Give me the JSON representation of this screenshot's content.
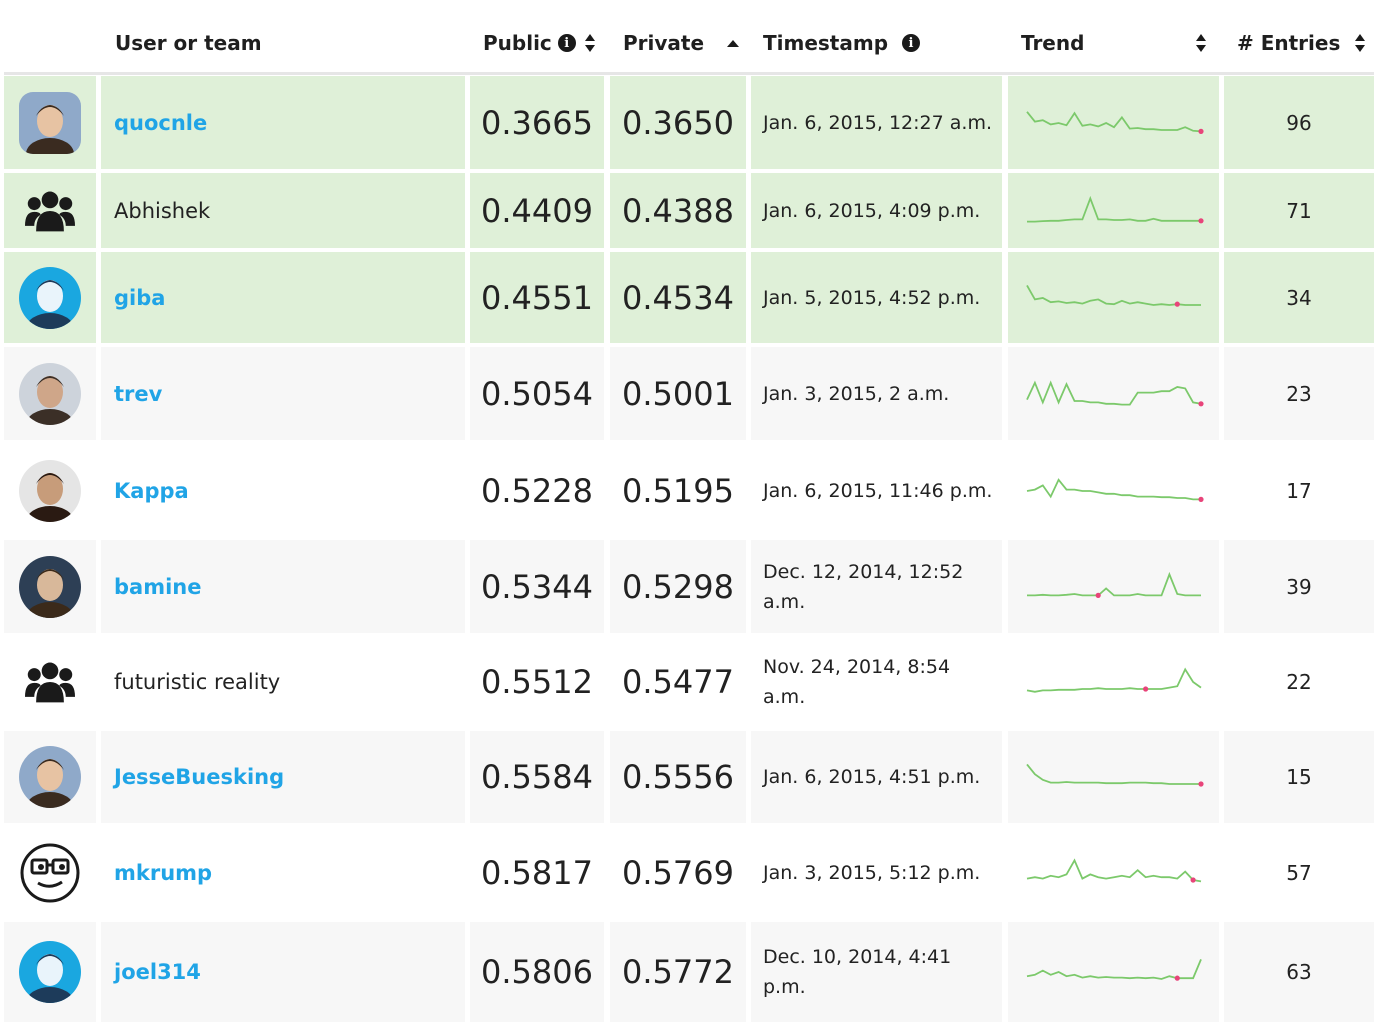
{
  "header": {
    "user_or_team": "User or team",
    "public": "Public",
    "private": "Private",
    "timestamp": "Timestamp",
    "trend": "Trend",
    "entries": "# Entries"
  },
  "colors": {
    "highlight_bg": "#dff0d8",
    "stripe_bg": "#f7f7f7",
    "link": "#20a4e6",
    "trend_line": "#7cc96b",
    "trend_dot": "#e8447a"
  },
  "rows": [
    {
      "name": "quocnle",
      "is_team": false,
      "avatar": "avatar-photo",
      "public": "0.3665",
      "private": "0.3650",
      "timestamp": "Jan. 6, 2015, 12:27 a.m.",
      "entries": "96",
      "highlight": true,
      "trend": [
        0.9,
        0.55,
        0.6,
        0.45,
        0.5,
        0.42,
        0.85,
        0.4,
        0.45,
        0.38,
        0.5,
        0.35,
        0.7,
        0.3,
        0.32,
        0.28,
        0.28,
        0.25,
        0.25,
        0.25,
        0.35,
        0.22,
        0.2
      ],
      "dot": 22
    },
    {
      "name": "Abhishek",
      "is_team": true,
      "avatar": "team-icon",
      "public": "0.4409",
      "private": "0.4388",
      "timestamp": "Jan. 6, 2015, 4:09 p.m.",
      "entries": "71",
      "highlight": true,
      "trend": [
        0.12,
        0.12,
        0.14,
        0.15,
        0.15,
        0.18,
        0.2,
        0.2,
        0.95,
        0.2,
        0.2,
        0.18,
        0.18,
        0.2,
        0.15,
        0.15,
        0.22,
        0.15,
        0.15,
        0.15,
        0.15,
        0.15,
        0.15
      ],
      "dot": 22
    },
    {
      "name": "giba",
      "is_team": false,
      "avatar": "avatar-photo",
      "public": "0.4551",
      "private": "0.4534",
      "timestamp": "Jan. 5, 2015, 4:52 p.m.",
      "entries": "34",
      "highlight": true,
      "trend": [
        0.95,
        0.45,
        0.5,
        0.35,
        0.38,
        0.32,
        0.35,
        0.3,
        0.4,
        0.45,
        0.3,
        0.28,
        0.4,
        0.3,
        0.35,
        0.3,
        0.25,
        0.28,
        0.25,
        0.28,
        0.25,
        0.25,
        0.25
      ],
      "dot": 19
    },
    {
      "name": "trev",
      "is_team": false,
      "avatar": "avatar-photo",
      "public": "0.5054",
      "private": "0.5001",
      "timestamp": "Jan. 3, 2015, 2 a.m.",
      "entries": "23",
      "highlight": false,
      "trend": [
        0.3,
        0.9,
        0.2,
        0.9,
        0.2,
        0.85,
        0.25,
        0.25,
        0.2,
        0.2,
        0.15,
        0.15,
        0.12,
        0.12,
        0.55,
        0.55,
        0.55,
        0.6,
        0.6,
        0.75,
        0.7,
        0.2,
        0.15
      ],
      "dot": 22
    },
    {
      "name": "Kappa",
      "is_team": false,
      "avatar": "avatar-photo",
      "public": "0.5228",
      "private": "0.5195",
      "timestamp": "Jan. 6, 2015, 11:46 p.m.",
      "entries": "17",
      "highlight": false,
      "trend": [
        0.5,
        0.55,
        0.7,
        0.3,
        0.9,
        0.55,
        0.55,
        0.5,
        0.5,
        0.45,
        0.4,
        0.4,
        0.35,
        0.35,
        0.3,
        0.3,
        0.3,
        0.28,
        0.28,
        0.25,
        0.25,
        0.2,
        0.2
      ],
      "dot": 22
    },
    {
      "name": "bamine",
      "is_team": false,
      "avatar": "avatar-photo",
      "public": "0.5344",
      "private": "0.5298",
      "timestamp": "Dec. 12, 2014, 12:52 a.m.",
      "entries": "39",
      "highlight": false,
      "trend": [
        0.2,
        0.2,
        0.22,
        0.2,
        0.2,
        0.22,
        0.25,
        0.2,
        0.2,
        0.2,
        0.45,
        0.2,
        0.2,
        0.2,
        0.25,
        0.2,
        0.2,
        0.2,
        0.95,
        0.25,
        0.2,
        0.2,
        0.2
      ],
      "dot": 9
    },
    {
      "name": "futuristic reality",
      "is_team": true,
      "avatar": "team-icon",
      "public": "0.5512",
      "private": "0.5477",
      "timestamp": "Nov. 24, 2014, 8:54 a.m.",
      "entries": "22",
      "highlight": false,
      "trend": [
        0.2,
        0.15,
        0.2,
        0.2,
        0.22,
        0.22,
        0.22,
        0.25,
        0.25,
        0.28,
        0.25,
        0.25,
        0.25,
        0.28,
        0.25,
        0.25,
        0.25,
        0.25,
        0.3,
        0.35,
        0.95,
        0.5,
        0.3
      ],
      "dot": 15
    },
    {
      "name": "JesseBuesking",
      "is_team": false,
      "avatar": "avatar-photo",
      "public": "0.5584",
      "private": "0.5556",
      "timestamp": "Jan. 6, 2015, 4:51 p.m.",
      "entries": "15",
      "highlight": false,
      "trend": [
        0.95,
        0.6,
        0.4,
        0.3,
        0.3,
        0.32,
        0.3,
        0.3,
        0.3,
        0.3,
        0.28,
        0.28,
        0.28,
        0.3,
        0.3,
        0.3,
        0.28,
        0.28,
        0.25,
        0.25,
        0.25,
        0.25,
        0.25
      ],
      "dot": 22
    },
    {
      "name": "mkrump",
      "is_team": false,
      "avatar": "geek-icon",
      "public": "0.5817",
      "private": "0.5769",
      "timestamp": "Jan. 3, 2015, 5:12 p.m.",
      "entries": "57",
      "highlight": false,
      "trend": [
        0.3,
        0.35,
        0.3,
        0.4,
        0.35,
        0.45,
        0.95,
        0.3,
        0.45,
        0.35,
        0.3,
        0.35,
        0.4,
        0.35,
        0.6,
        0.35,
        0.4,
        0.35,
        0.35,
        0.3,
        0.55,
        0.25,
        0.2
      ],
      "dot": 21
    },
    {
      "name": "joel314",
      "is_team": false,
      "avatar": "avatar-photo",
      "public": "0.5806",
      "private": "0.5772",
      "timestamp": "Dec. 10, 2014, 4:41 p.m.",
      "entries": "63",
      "highlight": false,
      "trend": [
        0.35,
        0.4,
        0.55,
        0.4,
        0.5,
        0.35,
        0.4,
        0.3,
        0.35,
        0.3,
        0.32,
        0.3,
        0.3,
        0.28,
        0.3,
        0.28,
        0.3,
        0.25,
        0.35,
        0.28,
        0.28,
        0.28,
        0.95
      ],
      "dot": 19
    }
  ]
}
